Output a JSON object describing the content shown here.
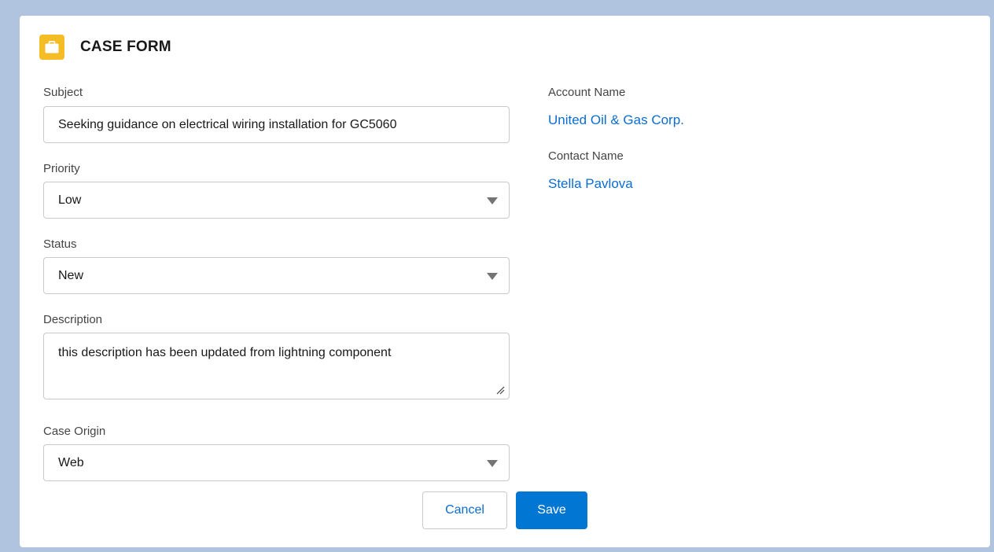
{
  "form": {
    "title": "CASE FORM",
    "icon": "case-briefcase-icon",
    "icon_color": "#f4bc25"
  },
  "subject": {
    "label": "Subject",
    "value": "Seeking guidance on electrical wiring installation for GC5060"
  },
  "priority": {
    "label": "Priority",
    "value": "Low"
  },
  "status": {
    "label": "Status",
    "value": "New"
  },
  "description": {
    "label": "Description",
    "value": "this description has been updated from lightning component"
  },
  "case_origin": {
    "label": "Case Origin",
    "value": "Web"
  },
  "account": {
    "label": "Account Name",
    "value": "United Oil & Gas Corp."
  },
  "contact": {
    "label": "Contact Name",
    "value": "Stella Pavlova"
  },
  "actions": {
    "cancel_label": "Cancel",
    "save_label": "Save"
  },
  "colors": {
    "brand": "#0176d3",
    "link": "#0b6dd1",
    "background": "#b0c4df"
  }
}
